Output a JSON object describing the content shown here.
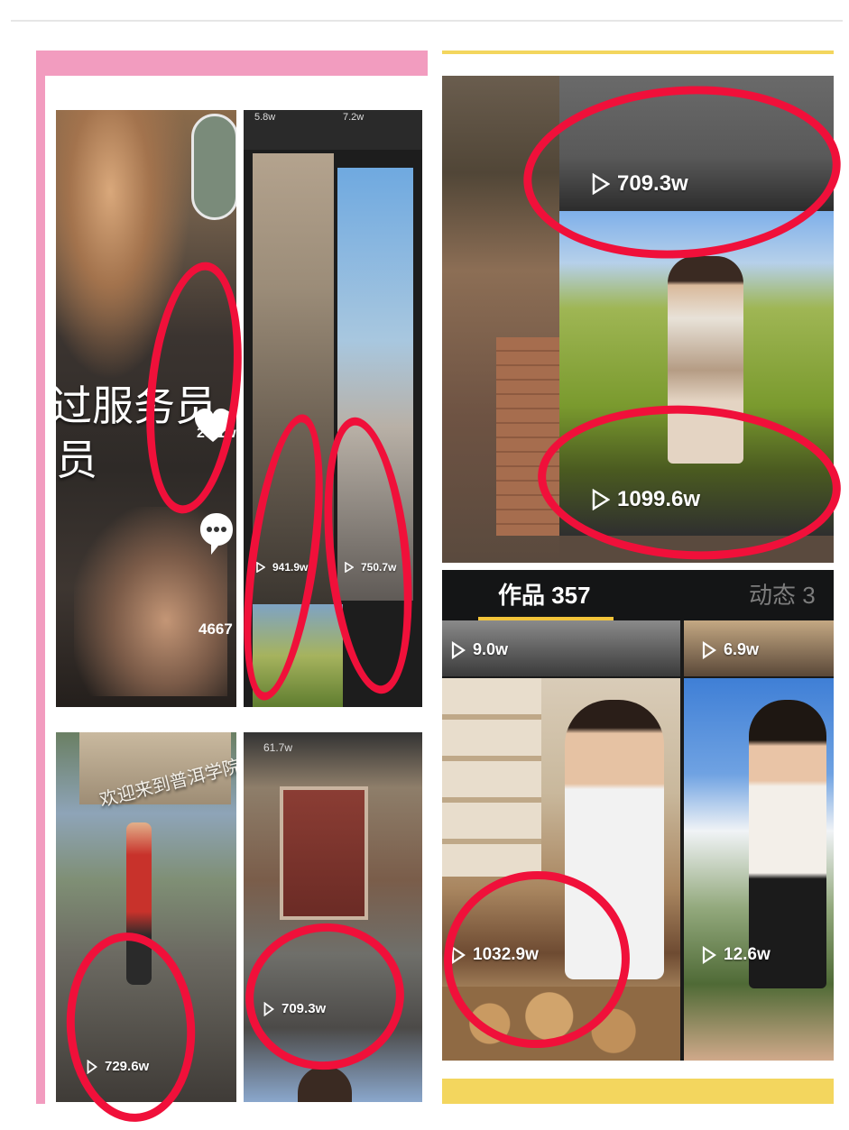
{
  "colors": {
    "pink_bar": "#f29cbf",
    "gold_bar": "#f3d65e",
    "circle_red": "#f0103a",
    "tab_underline": "#f3c43a"
  },
  "left_panel": {
    "top_left": {
      "caption_line1": "过服务员，收银",
      "caption_line2": "员",
      "like_count": "26.1w",
      "comment_count": "4667",
      "icons": [
        "heart-icon",
        "comment-icon",
        "avatar"
      ]
    },
    "top_right": {
      "views_left": "941.9w",
      "views_right": "750.7w",
      "top_left_count": "5.8w",
      "top_right_count": "7.2w"
    },
    "bottom_left": {
      "banner_text": "欢迎来到普洱学院",
      "views": "729.6w"
    },
    "bottom_right": {
      "top_count": "61.7w",
      "views": "709.3w"
    }
  },
  "right_panel": {
    "top": {
      "views_1": "709.3w",
      "views_2": "1099.6w"
    },
    "profile": {
      "tab_works": "作品 357",
      "tab_dynamic": "动态 3",
      "grid": [
        {
          "views": "9.0w"
        },
        {
          "views": "6.9w"
        },
        {
          "views": "1032.9w"
        },
        {
          "views": "12.6w"
        }
      ]
    }
  }
}
